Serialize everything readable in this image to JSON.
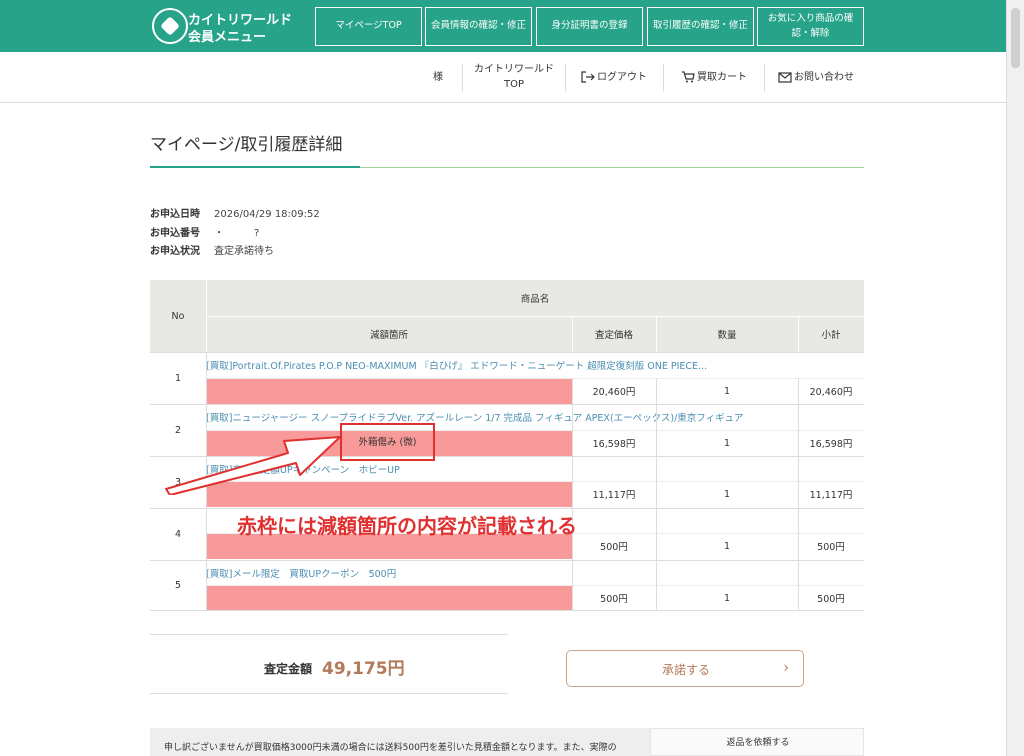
{
  "header": {
    "logo_line1": "カイトリワールド",
    "logo_line2": "会員メニュー",
    "nav": [
      "マイページTOP",
      "会員情報の確認・修正",
      "身分証明書の登録",
      "取引履歴の確認・修正",
      "お気に入り商品の確認・解除"
    ],
    "accent_color": "#26a389"
  },
  "subnav": {
    "user_suffix": "様",
    "top_link": "カイトリワールド TOP",
    "logout": "ログアウト",
    "cart": "買取カート",
    "contact": "お問い合わせ"
  },
  "page_title": "マイページ/取引履歴詳細",
  "info": {
    "date_label": "お申込日時",
    "date_value": "2026/04/29 18:09:52",
    "number_label": "お申込番号",
    "number_value": "・　　　?",
    "status_label": "お申込状況",
    "status_value": "査定承諾待ち"
  },
  "table": {
    "headers": {
      "no": "No",
      "product": "商品名",
      "deduction": "減額箇所",
      "price": "査定価格",
      "qty": "数量",
      "subtotal": "小計"
    },
    "rows": [
      {
        "no": "1",
        "name": "[買取]Portrait.Of.Pirates P.O.P NEO-MAXIMUM 『白ひげ』 エドワード・ニューゲート 超限定復刻版 ONE PIECE...",
        "price": "20,460円",
        "qty": "1",
        "subtotal": "20,460円"
      },
      {
        "no": "2",
        "name": "[買取]ニュージャージー スノープライドラブVer. アズールレーン 1/7 完成品 フィギュア APEX(エーペックス)/東京フィギュア",
        "price": "16,598円",
        "qty": "1",
        "subtotal": "16,598円"
      },
      {
        "no": "3",
        "name": "[買取]商品査定額UPキャンペーン　ホビーUP",
        "price": "11,117円",
        "qty": "1",
        "subtotal": "11,117円"
      },
      {
        "no": "4",
        "name": "",
        "price": "500円",
        "qty": "1",
        "subtotal": "500円"
      },
      {
        "no": "5",
        "name": "[買取]メール限定　買取UPクーポン　500円",
        "price": "500円",
        "qty": "1",
        "subtotal": "500円"
      }
    ]
  },
  "annotation": {
    "box_text": "外箱傷み (微)",
    "caption": "赤枠には減額箇所の内容が記載される",
    "color": "#e03030"
  },
  "total": {
    "label": "査定金額",
    "value": "49,175円"
  },
  "accept_label": "承諾する",
  "notice_text": "申し訳ございませんが買取価格3000円未満の場合には送料500円を差引いた見積金額となります。また、実際の",
  "return_label": "返品を依頼する"
}
